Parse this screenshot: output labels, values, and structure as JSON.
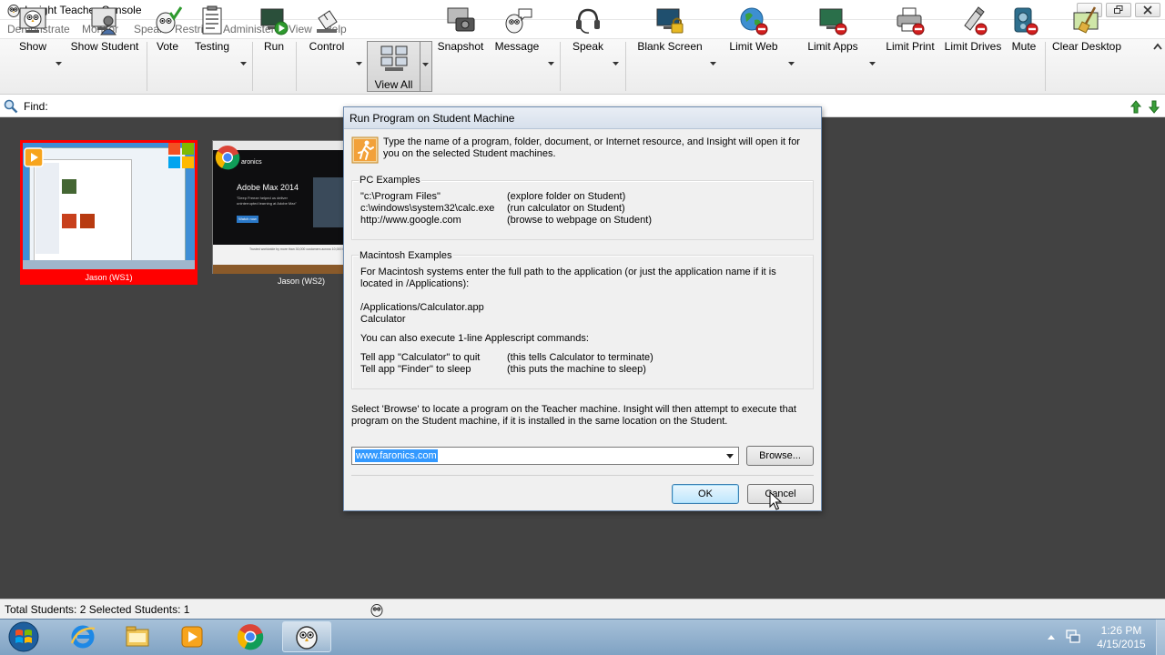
{
  "window": {
    "title": "Insight Teacher Console"
  },
  "menu": [
    "Demonstrate",
    "Monitor",
    "Speak",
    "Restrict",
    "Administer",
    "View",
    "Help"
  ],
  "toolbar": {
    "show": "Show",
    "show_student": "Show Student",
    "vote": "Vote",
    "testing": "Testing",
    "run": "Run",
    "control": "Control",
    "view_all": "View All",
    "snapshot": "Snapshot",
    "message": "Message",
    "speak": "Speak",
    "blank_screen": "Blank Screen",
    "limit_web": "Limit Web",
    "limit_apps": "Limit Apps",
    "limit_print": "Limit Print",
    "limit_drives": "Limit Drives",
    "mute": "Mute",
    "clear_desktop": "Clear Desktop"
  },
  "find": {
    "label": "Find:"
  },
  "students": [
    {
      "name": "Jason (WS1)",
      "selected": true
    },
    {
      "name": "Jason (WS2)",
      "selected": false,
      "screen": {
        "brand": "aronics",
        "headline": "Adobe Max 2014",
        "body": "\"Deep Freeze helped us deliver uninterrupted learning at Adobe Max\"",
        "button": "Watch now",
        "footer": "Trusted worldwide by more than 30,000 customers across 10,000 locations"
      }
    }
  ],
  "status": {
    "text": "Total Students: 2  Selected Students: 1"
  },
  "dialog": {
    "title": "Run Program on Student Machine",
    "intro": "Type the name of a program, folder, document, or Internet resource, and Insight will open it for you on the selected Student machines.",
    "pc": {
      "heading": "PC Examples",
      "rows": [
        {
          "cmd": "\"c:\\Program Files\"",
          "desc": "(explore folder on Student)"
        },
        {
          "cmd": "c:\\windows\\system32\\calc.exe",
          "desc": "(run calculator on Student)"
        },
        {
          "cmd": "http://www.google.com",
          "desc": "(browse to webpage on Student)"
        }
      ]
    },
    "mac": {
      "heading": "Macintosh Examples",
      "line1": "For Macintosh systems enter the full path to the application (or just the application name if it is",
      "line2": "located in /Applications):",
      "path1": "/Applications/Calculator.app",
      "path2": "Calculator",
      "applescript_note": "You can also execute 1-line Applescript commands:",
      "rows": [
        {
          "cmd": "Tell app \"Calculator\" to quit",
          "desc": "(this tells Calculator to terminate)"
        },
        {
          "cmd": "Tell app \"Finder\" to sleep",
          "desc": "(this puts the machine to sleep)"
        }
      ]
    },
    "browse_note_1": "Select 'Browse' to locate a program on the Teacher machine. Insight will then attempt to execute that",
    "browse_note_2": "program on the Student machine, if it is installed in the same location on the Student.",
    "input_value": "www.faronics.com",
    "browse_label": "Browse...",
    "ok_label": "OK",
    "cancel_label": "Cancel"
  },
  "taskbar": {
    "time": "1:26 PM",
    "date": "4/15/2015"
  },
  "colors": {
    "selection_red": "#ff0000",
    "workspace": "#424242",
    "taskbar": "#8eaccb",
    "highlight": "#3399ff"
  }
}
